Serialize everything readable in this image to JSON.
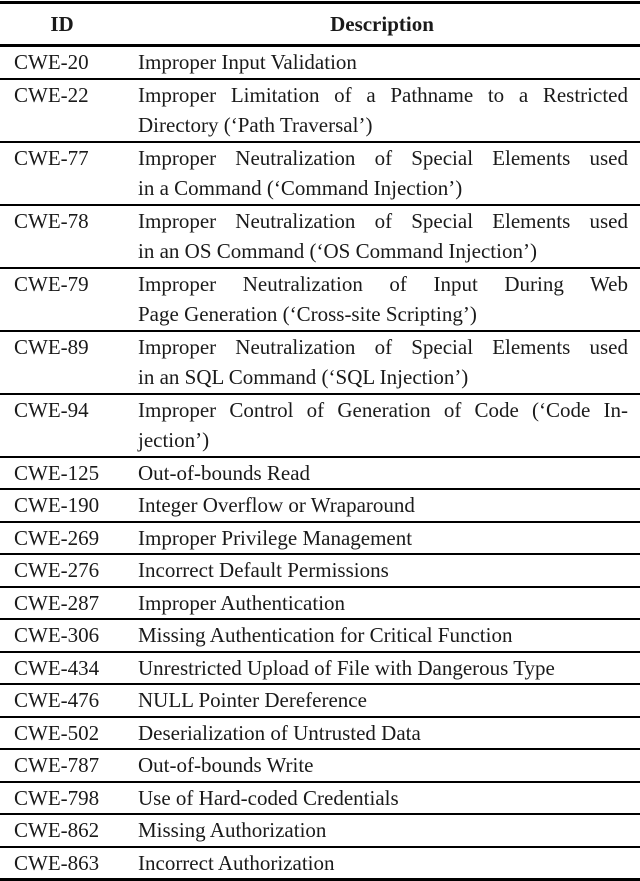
{
  "table": {
    "headers": {
      "id": "ID",
      "description": "Description"
    },
    "rows": [
      {
        "id": "CWE-20",
        "lines": [
          "Improper Input Validation"
        ]
      },
      {
        "id": "CWE-22",
        "lines": [
          "Improper Limitation of a Pathname to a Restricted",
          "Directory (‘Path Traversal’)"
        ]
      },
      {
        "id": "CWE-77",
        "lines": [
          "Improper Neutralization of Special Elements used",
          "in a Command (‘Command Injection’)"
        ]
      },
      {
        "id": "CWE-78",
        "lines": [
          "Improper Neutralization of Special Elements used",
          "in an OS Command (‘OS Command Injection’)"
        ]
      },
      {
        "id": "CWE-79",
        "lines": [
          "Improper Neutralization of Input During Web",
          "Page Generation (‘Cross-site Scripting’)"
        ]
      },
      {
        "id": "CWE-89",
        "lines": [
          "Improper Neutralization of Special Elements used",
          "in an SQL Command (‘SQL Injection’)"
        ]
      },
      {
        "id": "CWE-94",
        "lines": [
          "Improper Control of Generation of Code (‘Code In-",
          "jection’)"
        ]
      },
      {
        "id": "CWE-125",
        "lines": [
          "Out-of-bounds Read"
        ]
      },
      {
        "id": "CWE-190",
        "lines": [
          "Integer Overflow or Wraparound"
        ]
      },
      {
        "id": "CWE-269",
        "lines": [
          "Improper Privilege Management"
        ]
      },
      {
        "id": "CWE-276",
        "lines": [
          "Incorrect Default Permissions"
        ]
      },
      {
        "id": "CWE-287",
        "lines": [
          "Improper Authentication"
        ]
      },
      {
        "id": "CWE-306",
        "lines": [
          "Missing Authentication for Critical Function"
        ]
      },
      {
        "id": "CWE-434",
        "lines": [
          "Unrestricted Upload of File with Dangerous Type"
        ]
      },
      {
        "id": "CWE-476",
        "lines": [
          "NULL Pointer Dereference"
        ]
      },
      {
        "id": "CWE-502",
        "lines": [
          "Deserialization of Untrusted Data"
        ]
      },
      {
        "id": "CWE-787",
        "lines": [
          "Out-of-bounds Write"
        ]
      },
      {
        "id": "CWE-798",
        "lines": [
          "Use of Hard-coded Credentials"
        ]
      },
      {
        "id": "CWE-862",
        "lines": [
          "Missing Authorization"
        ]
      },
      {
        "id": "CWE-863",
        "lines": [
          "Incorrect Authorization"
        ]
      }
    ]
  }
}
